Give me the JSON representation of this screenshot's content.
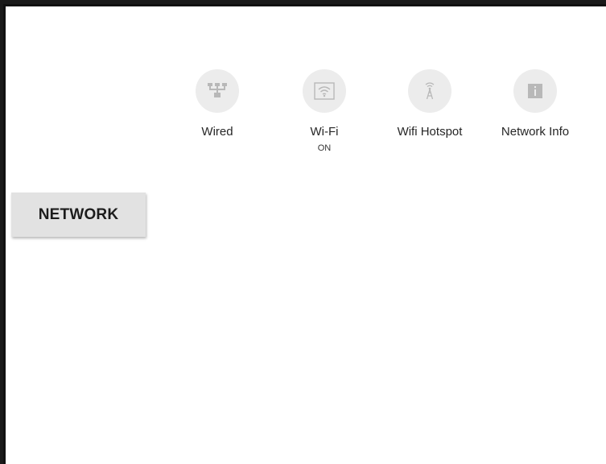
{
  "sidebar": {
    "active_category": "NETWORK"
  },
  "options": [
    {
      "label": "Wired",
      "sublabel": "",
      "icon": "ethernet-icon"
    },
    {
      "label": "Wi-Fi",
      "sublabel": "ON",
      "icon": "wifi-icon"
    },
    {
      "label": "Wifi Hotspot",
      "sublabel": "",
      "icon": "hotspot-icon"
    },
    {
      "label": "Network Info",
      "sublabel": "",
      "icon": "info-icon"
    }
  ],
  "colors": {
    "tab_background": "#e2e2e2",
    "icon_circle": "#ececec",
    "icon_glyph": "#b8b8b8"
  }
}
